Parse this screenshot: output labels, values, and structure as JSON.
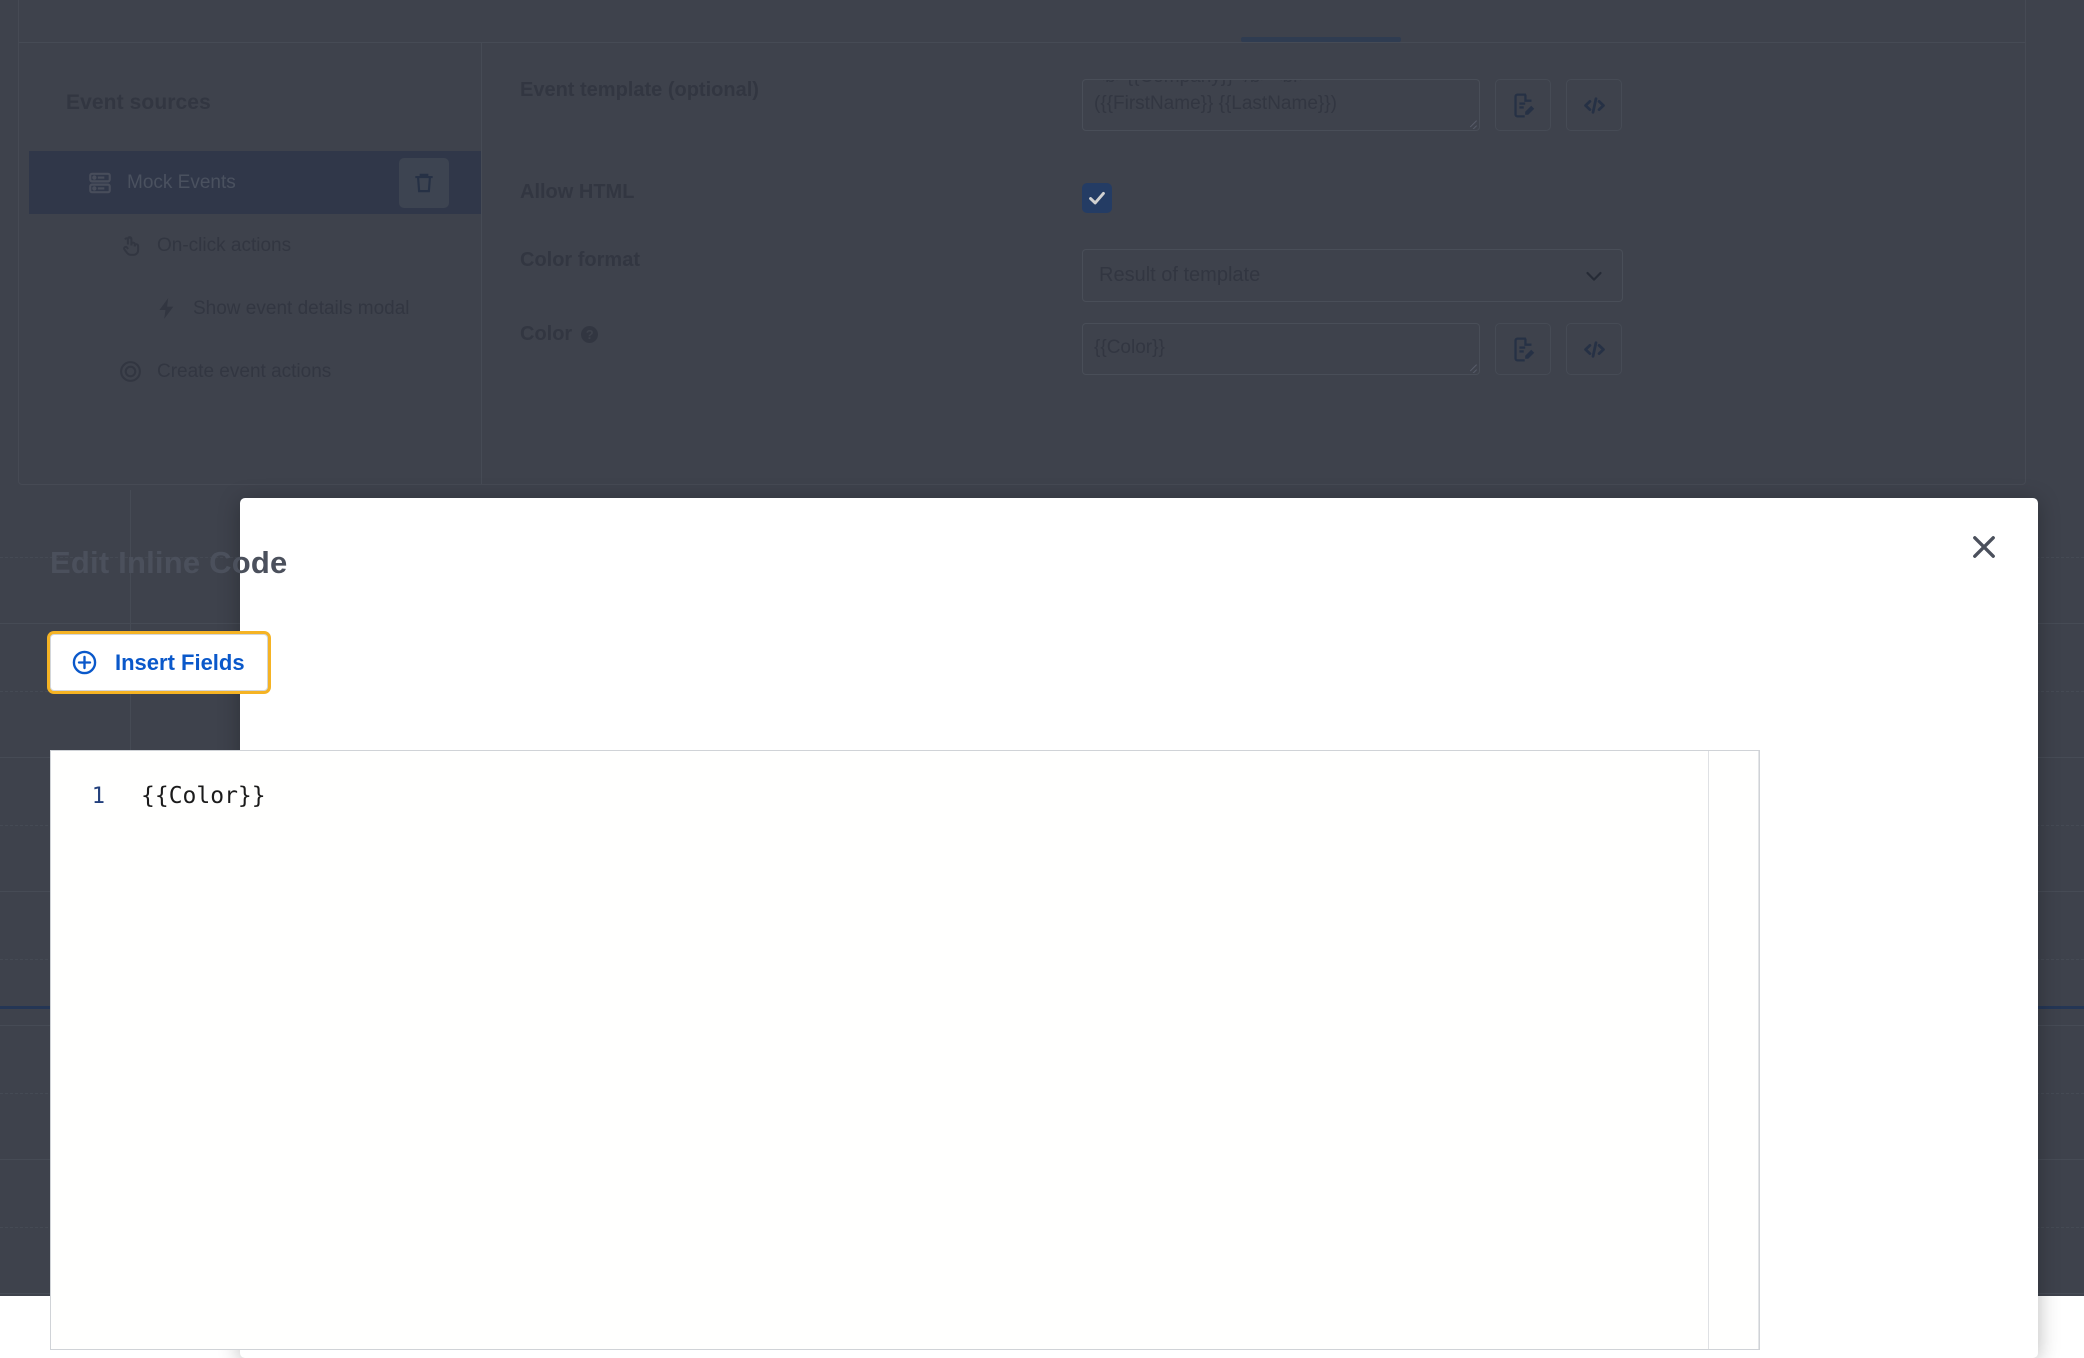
{
  "background": {
    "event_sources": {
      "heading": "Event sources",
      "items": [
        {
          "label": "Mock Events",
          "icon": "database-icon",
          "selected": true,
          "depth": 0,
          "has_delete": true,
          "delete_icon": "trash-icon"
        },
        {
          "label": "On-click actions",
          "icon": "click-hand-icon",
          "selected": false,
          "depth": 1,
          "has_delete": false
        },
        {
          "label": "Show event details modal",
          "icon": "lightning-bolt-icon",
          "selected": false,
          "depth": 2,
          "has_delete": false
        },
        {
          "label": "Create event actions",
          "icon": "target-icon",
          "selected": false,
          "depth": 1,
          "has_delete": false
        }
      ]
    },
    "form": {
      "event_template": {
        "label": "Event template (optional)",
        "value_scrolled_line": "<b>{{Company}}</b><br>",
        "value_visible_line": "({{FirstName}} {{LastName}})",
        "doc_button_icon": "document-edit-icon",
        "code_button_icon": "inline-code-icon"
      },
      "allow_html": {
        "label": "Allow HTML",
        "checked": true,
        "checkbox_color": "#2d4a7a"
      },
      "color_format": {
        "label": "Color format",
        "selected_option": "Result of template",
        "chevron_icon": "chevron-down-icon"
      },
      "color": {
        "label": "Color",
        "help_icon": "question-mark-icon",
        "value": "{{Color}}",
        "doc_button_icon": "document-edit-icon",
        "code_button_icon": "inline-code-icon"
      }
    }
  },
  "modal": {
    "title": "Edit Inline Code",
    "close_icon": "close-icon",
    "insert_fields": {
      "label": "Insert Fields",
      "icon": "plus-circle-icon",
      "text_color": "#0a58ca",
      "focus_ring_color": "#f5b324"
    },
    "editor": {
      "line_numbers": [
        "1"
      ],
      "lines": [
        "{{Color}}"
      ],
      "line_number_color": "#23407c"
    }
  }
}
